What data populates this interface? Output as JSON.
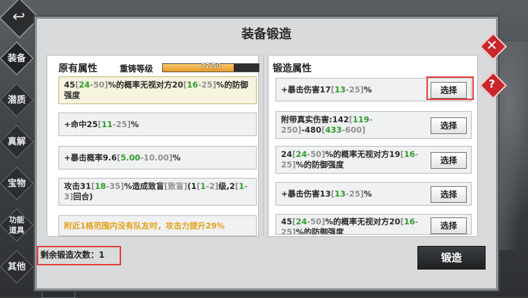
{
  "dialog": {
    "title": "装备锻造"
  },
  "side_tabs": [
    {
      "label": "装备"
    },
    {
      "label": "潜质"
    },
    {
      "label": "真解"
    },
    {
      "label": "宝物"
    },
    {
      "label": "功能道具"
    },
    {
      "label": "其他"
    }
  ],
  "bottom_tab": {
    "label": "装备"
  },
  "original": {
    "heading": "原有属性",
    "rebuild_label": "重铸等级",
    "rebuild_progress": "37/50",
    "rebuild_fraction": 0.74,
    "attrs": [
      {
        "parts": [
          "45",
          "[",
          "24",
          "-50",
          "]",
          "%的概率无视对方20",
          "[",
          "16",
          "-25",
          "]",
          "%的防御强度"
        ]
      },
      {
        "parts": [
          "+命中25",
          "[",
          "11",
          "-25",
          "]",
          "%"
        ]
      },
      {
        "parts": [
          "+暴击概率9.6",
          "[",
          "5.00",
          "-10.00",
          "]",
          "%"
        ]
      },
      {
        "parts": [
          "攻击31",
          "[",
          "18",
          "-35",
          "]",
          "%造成致盲",
          "[致盲]",
          "(1",
          "[",
          "1",
          "-2",
          "]",
          "级,2",
          "[",
          "1",
          "-3",
          "]",
          "回合)"
        ]
      },
      {
        "text": "附近1格范围内没有队友时，攻击力提升29%"
      }
    ]
  },
  "forge": {
    "heading": "锻造属性",
    "select_label": "选择",
    "attrs": [
      {
        "parts": [
          "+暴击伤害17",
          "[",
          "13",
          "-25",
          "]",
          "%"
        ]
      },
      {
        "parts": [
          "附带真实伤害:142",
          "[",
          "119",
          "-250",
          "]",
          "-480",
          "[",
          "433",
          "-600",
          "]"
        ]
      },
      {
        "parts": [
          "24",
          "[",
          "24",
          "-50",
          "]",
          "%的概率无视对方19",
          "[",
          "16",
          "-25",
          "]",
          "%的防御强度"
        ]
      },
      {
        "parts": [
          "+暴击伤害13",
          "[",
          "13",
          "-25",
          "]",
          "%"
        ]
      },
      {
        "parts": [
          "45",
          "[",
          "24",
          "-50",
          "]",
          "%的概率无视对方20",
          "[",
          "16",
          "-25",
          "]",
          "%的防御强度"
        ]
      }
    ]
  },
  "remaining": {
    "label": "剩余锻造次数：1"
  },
  "forge_button": {
    "label": "锻造"
  },
  "close_button": {
    "symbol": "✕"
  },
  "help_button": {
    "symbol": "?"
  },
  "back_button": {
    "symbol": "↩"
  },
  "colors": {
    "highlight_red": "#e33b3b",
    "green": "#2e9b2e",
    "gray": "#8f8f8f",
    "orange": "#e3a21a"
  }
}
